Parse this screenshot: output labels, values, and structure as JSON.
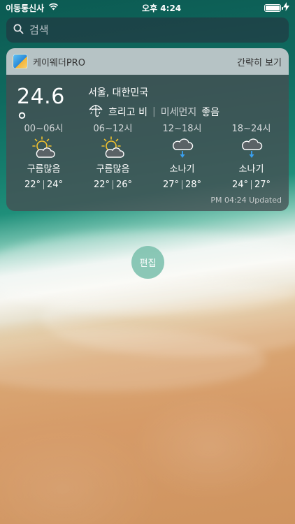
{
  "status_bar": {
    "carrier": "이동통신사",
    "time": "오후 4:24",
    "wifi_icon": "wifi-icon",
    "battery_icon": "battery-icon",
    "charging_icon": "charging-bolt-icon",
    "battery_level": 1.0
  },
  "search": {
    "placeholder": "검색",
    "icon": "search-icon"
  },
  "widget": {
    "app_name": "케이웨더PRO",
    "app_icon": "kweather-app-icon",
    "collapse_label": "간략히 보기",
    "current": {
      "temperature": "24.6 °",
      "location": "서울, 대한민국",
      "condition_icon": "umbrella-rain-icon",
      "condition": "흐리고 비",
      "dust_label": "미세먼지",
      "dust_value": "좋음"
    },
    "forecast": [
      {
        "time": "00~06시",
        "icon": "partly-cloudy-sun-icon",
        "condition": "구름많음",
        "low": "22°",
        "high": "24°"
      },
      {
        "time": "06~12시",
        "icon": "partly-cloudy-sun-icon",
        "condition": "구름많음",
        "low": "22°",
        "high": "26°"
      },
      {
        "time": "12~18시",
        "icon": "rain-shower-icon",
        "condition": "소나기",
        "low": "27°",
        "high": "28°"
      },
      {
        "time": "18~24시",
        "icon": "rain-shower-icon",
        "condition": "소나기",
        "low": "24°",
        "high": "27°"
      }
    ],
    "updated": "PM 04:24 Updated"
  },
  "edit_button": {
    "label": "편집"
  },
  "colors": {
    "widget_header": "#d2dcde",
    "widget_body": "#464e52",
    "sun_yellow": "#f2c12e",
    "rain_blue": "#3aa0f0",
    "edit_button": "#78beaa"
  }
}
